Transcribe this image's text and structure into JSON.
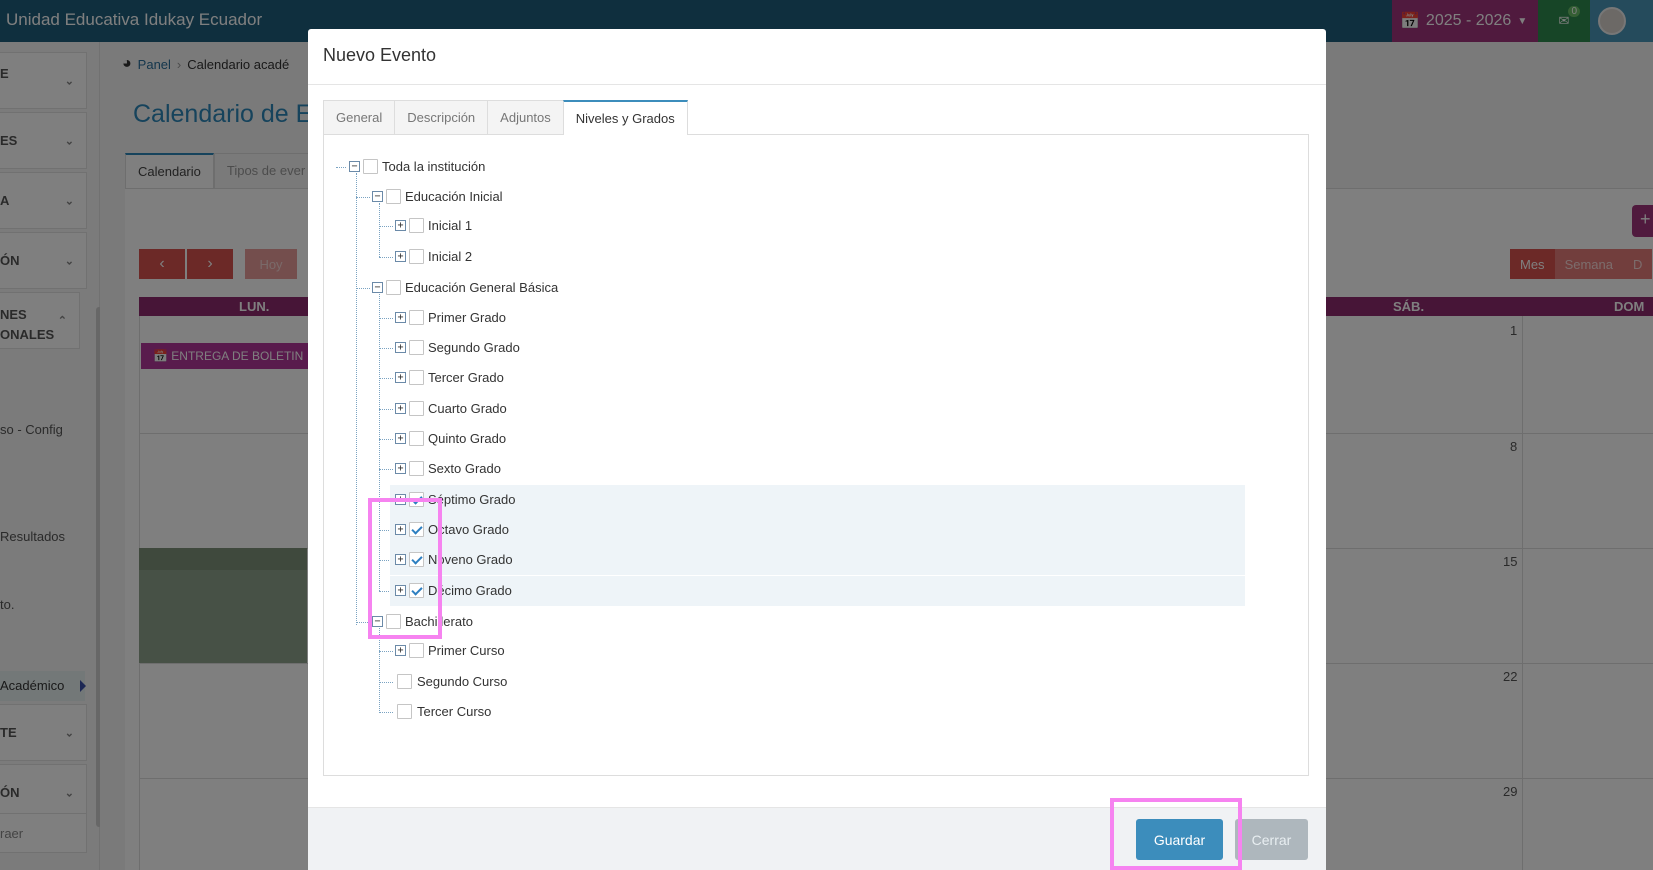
{
  "app": {
    "title": "Unidad Educativa Idukay Ecuador",
    "year": "2025 - 2026",
    "mail_count": "0"
  },
  "sidebar": {
    "items": [
      {
        "label": "E"
      },
      {
        "label": "ES"
      },
      {
        "label": "A"
      },
      {
        "label": "ÓN"
      },
      {
        "label": "NES ONALES"
      },
      {
        "label": "TE"
      },
      {
        "label": "ÓN"
      }
    ],
    "subitems": [
      {
        "label": "so - Config"
      },
      {
        "label": "Resultados"
      },
      {
        "label": "to."
      }
    ],
    "active": "Académico",
    "footer": "raer"
  },
  "breadcrumb": {
    "home": "Panel",
    "current": "Calendario acadé"
  },
  "page": {
    "title": "Calendario de Ev"
  },
  "bg_tabs": [
    {
      "label": "Calendario"
    },
    {
      "label": "Tipos de ever"
    }
  ],
  "calendar": {
    "today": "Hoy",
    "views": [
      "Mes",
      "Semana",
      "D"
    ],
    "headers": [
      "LUN.",
      "SÁB.",
      "DOM"
    ],
    "event": "ENTREGA DE BOLETIN",
    "days": [
      "1",
      "8",
      "15",
      "22",
      "29"
    ]
  },
  "modal": {
    "title": "Nuevo Evento",
    "tabs": [
      {
        "label": "General"
      },
      {
        "label": "Descripción"
      },
      {
        "label": "Adjuntos"
      },
      {
        "label": "Niveles y Grados"
      }
    ],
    "tree": {
      "root": "Toda la institución",
      "inicial": {
        "label": "Educación Inicial",
        "items": [
          "Inicial 1",
          "Inicial 2"
        ]
      },
      "basica": {
        "label": "Educación General Básica",
        "items": [
          "Primer Grado",
          "Segundo Grado",
          "Tercer Grado",
          "Cuarto Grado",
          "Quinto Grado",
          "Sexto Grado",
          "Séptimo Grado",
          "Octavo Grado",
          "Noveno Grado",
          "Décimo Grado"
        ],
        "checked": [
          "Séptimo Grado",
          "Octavo Grado",
          "Noveno Grado",
          "Décimo Grado"
        ]
      },
      "bachillerato": {
        "label": "Bachillerato",
        "items": [
          "Primer Curso",
          "Segundo Curso",
          "Tercer Curso"
        ]
      }
    },
    "save": "Guardar",
    "close": "Cerrar"
  },
  "colors": {
    "accent": "#3c8dbc",
    "highlight": "#f683f0",
    "brand_bar": "#1f5f7d",
    "year": "#a1347d"
  }
}
